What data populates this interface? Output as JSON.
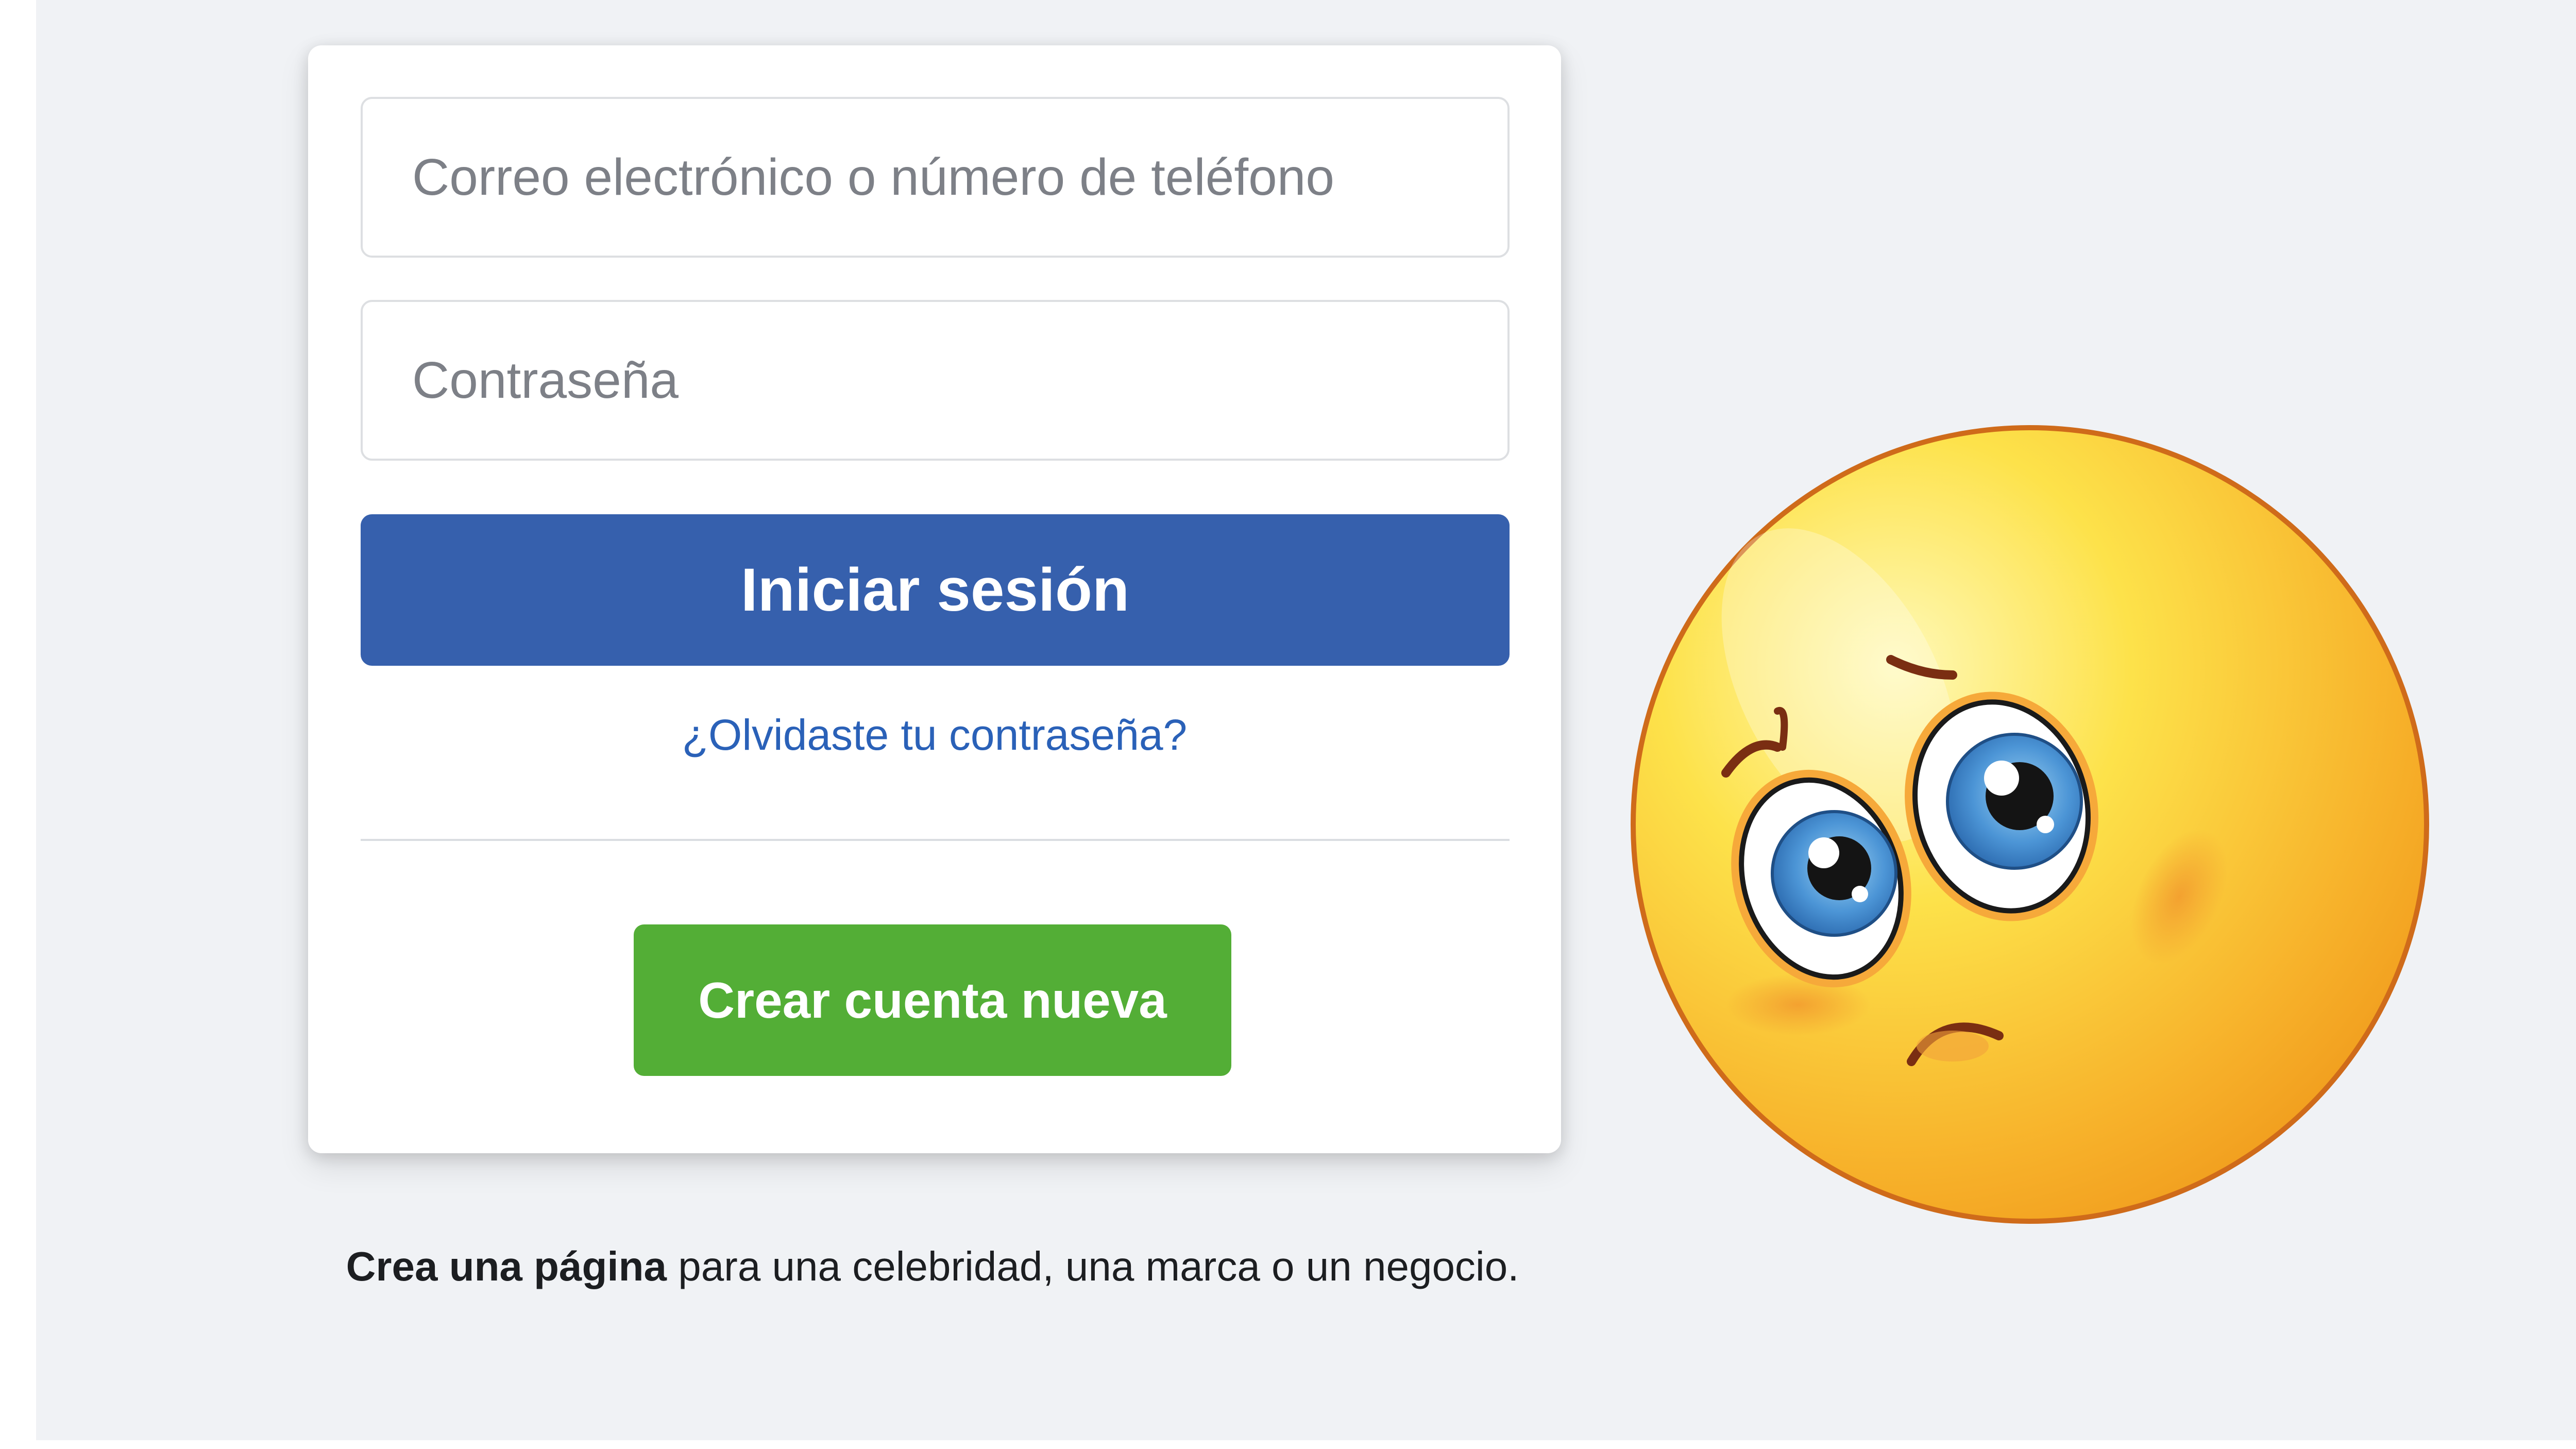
{
  "login": {
    "email_placeholder": "Correo electrónico o número de teléfono",
    "password_placeholder": "Contraseña",
    "login_button": "Iniciar sesión",
    "forgot_link": "¿Olvidaste tu contraseña?",
    "create_account_button": "Crear cuenta nueva"
  },
  "create_page": {
    "bold": "Crea una página",
    "rest": " para una celebridad, una marca o un negocio."
  },
  "illustration": {
    "icon": "sad-face-icon"
  },
  "colors": {
    "background": "#f0f2f5",
    "primary_button": "#3660ad",
    "create_button": "#53ae36",
    "link": "#2a61b8"
  }
}
